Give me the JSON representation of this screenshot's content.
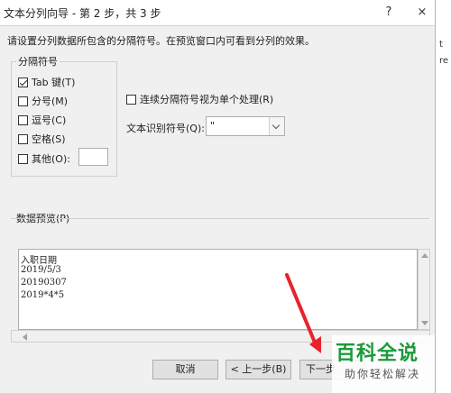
{
  "background": {
    "right_cells": [
      "t",
      "re"
    ]
  },
  "window": {
    "title": "文本分列向导 - 第 2 步，共 3 步",
    "help": "?",
    "close": "×"
  },
  "instruction": "请设置分列数据所包含的分隔符号。在预览窗口内可看到分列的效果。",
  "delimiters": {
    "title": "分隔符号",
    "options": [
      {
        "label": "Tab 键(T)",
        "checked": true
      },
      {
        "label": "分号(M)",
        "checked": false
      },
      {
        "label": "逗号(C)",
        "checked": false
      },
      {
        "label": "空格(S)",
        "checked": false
      },
      {
        "label": "其他(O):",
        "checked": false
      }
    ],
    "other_value": ""
  },
  "consecutive": {
    "label": "连续分隔符号视为单个处理(R)",
    "checked": false
  },
  "text_qualifier": {
    "label": "文本识别符号(Q):",
    "value": "\""
  },
  "preview": {
    "label": "数据预览(P)",
    "rows": [
      "入职日期",
      "2019/5/3",
      "20190307",
      "2019*4*5"
    ]
  },
  "buttons": {
    "cancel": "取消",
    "back": "< 上一步(B)",
    "next": "下一步"
  },
  "watermark": {
    "title": "百科全说",
    "subtitle": "助你轻松解决"
  },
  "colors": {
    "arrow": "#e8232a",
    "watermark_green": "#1a9a3a"
  }
}
